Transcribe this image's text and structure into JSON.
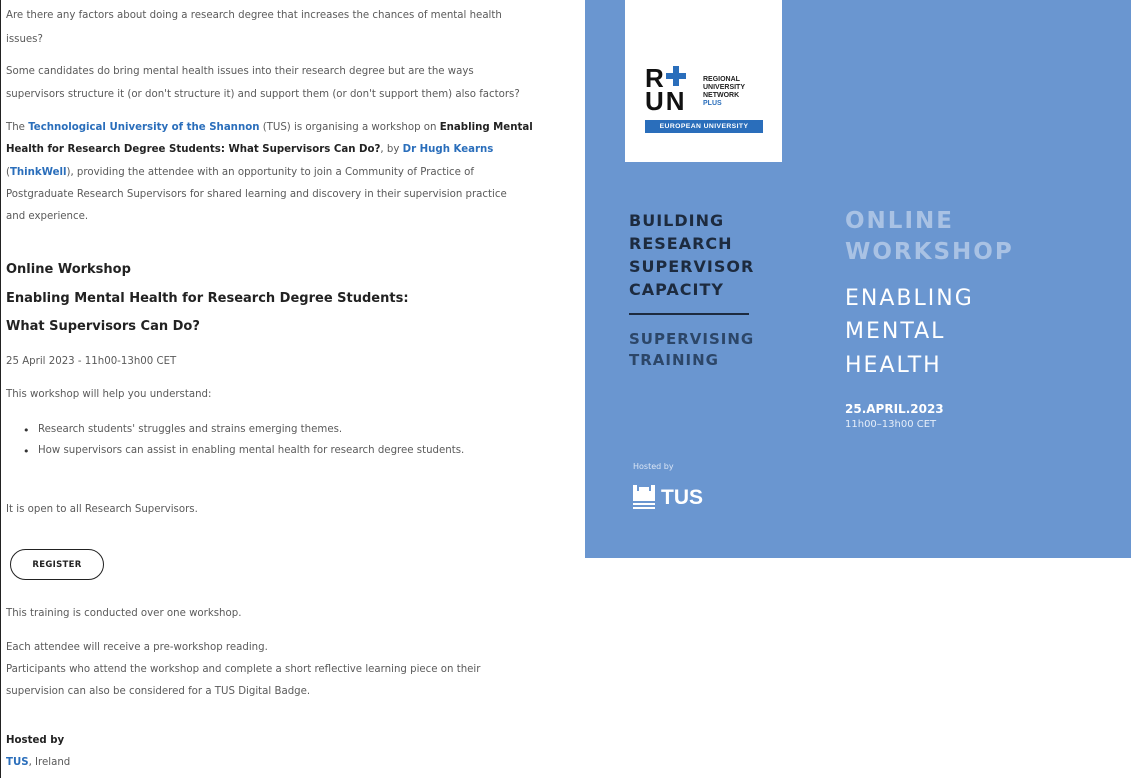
{
  "article": {
    "q1_line1": "Are there any factors about doing a research degree that increases the chances of mental health",
    "q1_line2": "issues?",
    "p2_line1": "Some candidates do bring mental health issues into their research degree but are the ways",
    "p2_line2": "supervisors structure it (or don't structure it) and support them (or don't support them) also factors?",
    "p3_pre": "The ",
    "p3_link_tus": "Technological University of the Shannon",
    "p3_a": " (TUS) is organising a workshop on ",
    "p3_bold1": "Enabling Mental",
    "p3_bold2": "Health for Research Degree Students: What Supervisors Can Do?",
    "p3_b": ", by ",
    "p3_link_hugh": "Dr Hugh Kearns",
    "p3_paren_open": "(",
    "p3_link_thinkwell": "ThinkWell",
    "p3_c": "), providing the attendee with an opportunity to join a Community of Practice of",
    "p3_line4": "Postgraduate Research Supervisors for shared learning and discovery in their supervision practice",
    "p3_line5": "and experience.",
    "h_online": "Online Workshop",
    "h_title1": "Enabling Mental Health for Research Degree Students:",
    "h_title2": "What Supervisors Can Do?",
    "date": "25 April 2023 - 11h00-13h00 CET",
    "intro": "This workshop will help you understand:",
    "bullets": [
      "Research students' struggles and strains emerging themes.",
      "How supervisors can assist in enabling mental health for research degree students."
    ],
    "open_to": "It is open to all Research Supervisors.",
    "register_label": "REGISTER",
    "conducted": "This training is conducted over one workshop.",
    "reading": "Each attendee will receive a pre-workshop reading.",
    "badge1": "Participants who attend the workshop and complete a short reflective learning piece on their",
    "badge2": "supervision can also be considered for a TUS Digital Badge.",
    "hosted_by": "Hosted by",
    "host_link": "TUS",
    "host_rest": ", Ireland"
  },
  "banner": {
    "run_letters_top": "R",
    "run_letters_bottom": "UN",
    "run_regional": "REGIONAL",
    "run_university": "UNIVERSITY",
    "run_network": "NETWORK",
    "run_plus": "PLUS",
    "eu_label": "EUROPEAN UNIVERSITY",
    "left_h1": "BUILDING",
    "left_h2": "RESEARCH",
    "left_h3": "SUPERVISOR",
    "left_h4": "CAPACITY",
    "left_h5": "SUPERVISING",
    "left_h6": "TRAINING",
    "right_h1": "ONLINE",
    "right_h2": "WORKSHOP",
    "right_h3": "ENABLING",
    "right_h4": "MENTAL",
    "right_h5": "HEALTH",
    "date": "25.APRIL.2023",
    "time": "11h00–13h00 CET",
    "hosted_by": "Hosted by",
    "tus": "TUS",
    "bg_color": "#6a96d0",
    "accent_blue": "#2a6ebb"
  }
}
